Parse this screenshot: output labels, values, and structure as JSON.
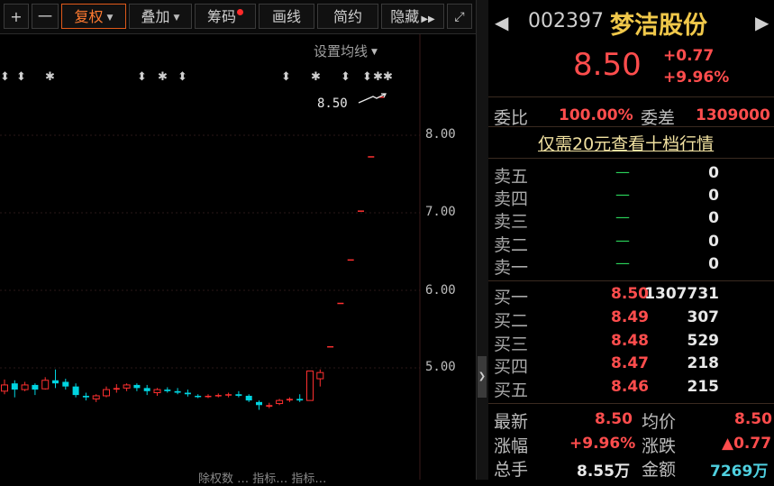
{
  "toolbar": {
    "plus": "+",
    "minus": "一",
    "fuquan": "复权",
    "diejia": "叠加",
    "chouma": "筹码",
    "huaxian": "画线",
    "jianyue": "简约",
    "yincang": "隐藏",
    "more_arrow": "▶▶",
    "fullscreen_icon": "expand-icon"
  },
  "chart": {
    "settings_label": "设置均线",
    "last_price_label": "8.50",
    "y_ticks": [
      "8.00",
      "7.00",
      "6.00",
      "5.00"
    ],
    "bottom_text": "除权数  …  指标…  指标…"
  },
  "chart_data": {
    "type": "candlestick",
    "y_range": [
      4.5,
      8.6
    ],
    "candles": [
      {
        "o": 4.7,
        "c": 4.78,
        "h": 4.85,
        "l": 4.66
      },
      {
        "o": 4.8,
        "c": 4.72,
        "h": 4.84,
        "l": 4.62
      },
      {
        "o": 4.72,
        "c": 4.78,
        "h": 4.82,
        "l": 4.7
      },
      {
        "o": 4.78,
        "c": 4.72,
        "h": 4.8,
        "l": 4.65
      },
      {
        "o": 4.73,
        "c": 4.84,
        "h": 4.88,
        "l": 4.72
      },
      {
        "o": 4.84,
        "c": 4.8,
        "h": 4.98,
        "l": 4.74
      },
      {
        "o": 4.82,
        "c": 4.76,
        "h": 4.86,
        "l": 4.72
      },
      {
        "o": 4.76,
        "c": 4.65,
        "h": 4.8,
        "l": 4.62
      },
      {
        "o": 4.64,
        "c": 4.62,
        "h": 4.68,
        "l": 4.58
      },
      {
        "o": 4.6,
        "c": 4.64,
        "h": 4.66,
        "l": 4.56
      },
      {
        "o": 4.64,
        "c": 4.72,
        "h": 4.76,
        "l": 4.62
      },
      {
        "o": 4.72,
        "c": 4.74,
        "h": 4.79,
        "l": 4.68
      },
      {
        "o": 4.74,
        "c": 4.78,
        "h": 4.8,
        "l": 4.7
      },
      {
        "o": 4.78,
        "c": 4.74,
        "h": 4.8,
        "l": 4.7
      },
      {
        "o": 4.74,
        "c": 4.7,
        "h": 4.78,
        "l": 4.65
      },
      {
        "o": 4.68,
        "c": 4.72,
        "h": 4.74,
        "l": 4.64
      },
      {
        "o": 4.72,
        "c": 4.7,
        "h": 4.75,
        "l": 4.68
      },
      {
        "o": 4.7,
        "c": 4.68,
        "h": 4.74,
        "l": 4.66
      },
      {
        "o": 4.68,
        "c": 4.66,
        "h": 4.72,
        "l": 4.63
      },
      {
        "o": 4.64,
        "c": 4.63,
        "h": 4.66,
        "l": 4.61
      },
      {
        "o": 4.63,
        "c": 4.64,
        "h": 4.66,
        "l": 4.61
      },
      {
        "o": 4.64,
        "c": 4.65,
        "h": 4.67,
        "l": 4.62
      },
      {
        "o": 4.65,
        "c": 4.66,
        "h": 4.68,
        "l": 4.62
      },
      {
        "o": 4.66,
        "c": 4.64,
        "h": 4.7,
        "l": 4.62
      },
      {
        "o": 4.64,
        "c": 4.58,
        "h": 4.66,
        "l": 4.56
      },
      {
        "o": 4.56,
        "c": 4.52,
        "h": 4.58,
        "l": 4.46
      },
      {
        "o": 4.5,
        "c": 4.52,
        "h": 4.55,
        "l": 4.48
      },
      {
        "o": 4.54,
        "c": 4.58,
        "h": 4.6,
        "l": 4.52
      },
      {
        "o": 4.58,
        "c": 4.6,
        "h": 4.62,
        "l": 4.56
      },
      {
        "o": 4.6,
        "c": 4.58,
        "h": 4.66,
        "l": 4.56
      },
      {
        "o": 4.58,
        "c": 4.96,
        "h": 4.96,
        "l": 4.58
      },
      {
        "o": 4.86,
        "c": 4.94,
        "h": 4.98,
        "l": 4.76
      },
      {
        "o": 5.28,
        "c": 5.28,
        "h": 5.28,
        "l": 5.28
      },
      {
        "o": 5.84,
        "c": 5.84,
        "h": 5.84,
        "l": 5.84
      },
      {
        "o": 6.4,
        "c": 6.4,
        "h": 6.4,
        "l": 6.4
      },
      {
        "o": 7.03,
        "c": 7.03,
        "h": 7.03,
        "l": 7.03
      },
      {
        "o": 7.73,
        "c": 7.73,
        "h": 7.73,
        "l": 7.73
      },
      {
        "o": 8.5,
        "c": 8.5,
        "h": 8.5,
        "l": 8.5
      }
    ],
    "colors": {
      "up": "#ff3030",
      "down": "#00d4e0"
    }
  },
  "stock": {
    "code": "002397",
    "name": "梦洁股份",
    "price": "8.50",
    "change": "+0.77",
    "change_pct": "+9.96%"
  },
  "weibi": {
    "label1": "委比",
    "value1": "100.00%",
    "label2": "委差",
    "value2": "1309000"
  },
  "promo": "仅需20元查看十档行情",
  "sell": [
    {
      "label": "卖五",
      "price": "—",
      "vol": "0"
    },
    {
      "label": "卖四",
      "price": "—",
      "vol": "0"
    },
    {
      "label": "卖三",
      "price": "—",
      "vol": "0"
    },
    {
      "label": "卖二",
      "price": "—",
      "vol": "0"
    },
    {
      "label": "卖一",
      "price": "—",
      "vol": "0"
    }
  ],
  "buy": [
    {
      "label": "买一",
      "price": "8.50",
      "vol": "1307731"
    },
    {
      "label": "买二",
      "price": "8.49",
      "vol": "307"
    },
    {
      "label": "买三",
      "price": "8.48",
      "vol": "529"
    },
    {
      "label": "买四",
      "price": "8.47",
      "vol": "218"
    },
    {
      "label": "买五",
      "price": "8.46",
      "vol": "215"
    }
  ],
  "stats": {
    "zuixin_l": "最新",
    "zuixin_v": "8.50",
    "junjia_l": "均价",
    "junjia_v": "8.50",
    "zhangfu_l": "涨幅",
    "zhangfu_v": "+9.96%",
    "zhangdie_l": "涨跌",
    "zhangdie_v": "▲0.77",
    "zongshou_l": "总手",
    "zongshou_v": "8.55万",
    "jine_l": "金额",
    "jine_v": "7269万"
  }
}
